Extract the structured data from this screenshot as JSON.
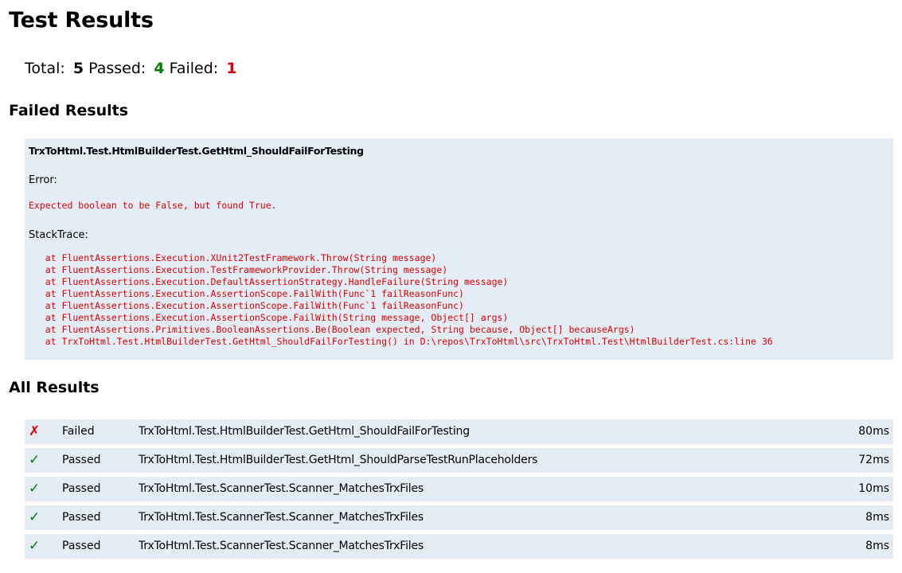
{
  "title": "Test Results",
  "summary": {
    "total_label": "Total:",
    "total": "5",
    "passed_label": "Passed:",
    "passed": "4",
    "failed_label": "Failed:",
    "failed": "1"
  },
  "colors": {
    "passed": "#008000",
    "failed": "#e00000",
    "row_background": "#e4ecf5"
  },
  "failed_section": {
    "heading": "Failed Results",
    "test_name": "TrxToHtml.Test.HtmlBuilderTest.GetHtml_ShouldFailForTesting",
    "error_label": "Error:",
    "error_message": "Expected boolean to be False, but found True.",
    "stack_label": "StackTrace:",
    "stack_trace": [
      "   at FluentAssertions.Execution.XUnit2TestFramework.Throw(String message)",
      "   at FluentAssertions.Execution.TestFrameworkProvider.Throw(String message)",
      "   at FluentAssertions.Execution.DefaultAssertionStrategy.HandleFailure(String message)",
      "   at FluentAssertions.Execution.AssertionScope.FailWith(Func`1 failReasonFunc)",
      "   at FluentAssertions.Execution.AssertionScope.FailWith(Func`1 failReasonFunc)",
      "   at FluentAssertions.Execution.AssertionScope.FailWith(String message, Object[] args)",
      "   at FluentAssertions.Primitives.BooleanAssertions.Be(Boolean expected, String because, Object[] becauseArgs)",
      "   at TrxToHtml.Test.HtmlBuilderTest.GetHtml_ShouldFailForTesting() in D:\\repos\\TrxToHtml\\src\\TrxToHtml.Test\\HtmlBuilderTest.cs:line 36"
    ]
  },
  "all_section": {
    "heading": "All Results",
    "rows": [
      {
        "icon": "cross-icon",
        "glyph": "✗",
        "status": "fail",
        "outcome": "Failed",
        "name": "TrxToHtml.Test.HtmlBuilderTest.GetHtml_ShouldFailForTesting",
        "duration": "80ms"
      },
      {
        "icon": "check-icon",
        "glyph": "✓",
        "status": "pass",
        "outcome": "Passed",
        "name": "TrxToHtml.Test.HtmlBuilderTest.GetHtml_ShouldParseTestRunPlaceholders",
        "duration": "72ms"
      },
      {
        "icon": "check-icon",
        "glyph": "✓",
        "status": "pass",
        "outcome": "Passed",
        "name": "TrxToHtml.Test.ScannerTest.Scanner_MatchesTrxFiles",
        "duration": "10ms"
      },
      {
        "icon": "check-icon",
        "glyph": "✓",
        "status": "pass",
        "outcome": "Passed",
        "name": "TrxToHtml.Test.ScannerTest.Scanner_MatchesTrxFiles",
        "duration": "8ms"
      },
      {
        "icon": "check-icon",
        "glyph": "✓",
        "status": "pass",
        "outcome": "Passed",
        "name": "TrxToHtml.Test.ScannerTest.Scanner_MatchesTrxFiles",
        "duration": "8ms"
      }
    ]
  }
}
